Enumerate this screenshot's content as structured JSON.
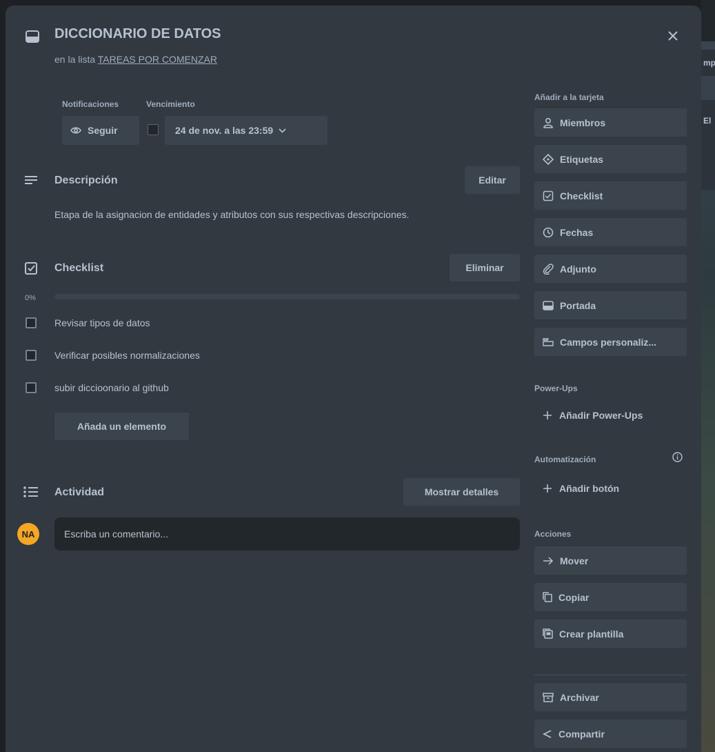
{
  "card": {
    "title": "DICCIONARIO DE DATOS",
    "list_prefix": "en la lista",
    "list_name": "TAREAS POR COMENZAR"
  },
  "meta": {
    "notifications_label": "Notificaciones",
    "due_label": "Vencimiento",
    "follow_button": "Seguir",
    "due_value": "24 de nov. a las 23:59"
  },
  "description": {
    "heading": "Descripción",
    "edit_button": "Editar",
    "text": "Etapa de la asignacion de entidades y atributos con sus respectivas descripciones."
  },
  "checklist": {
    "heading": "Checklist",
    "delete_button": "Eliminar",
    "progress_label": "0%",
    "progress_fraction": 0,
    "items": [
      {
        "text": "Revisar tipos de datos",
        "checked": false
      },
      {
        "text": "Verificar posibles normalizaciones",
        "checked": false
      },
      {
        "text": "subir diccioonario al github",
        "checked": false
      }
    ],
    "add_item_button": "Añada un elemento"
  },
  "activity": {
    "heading": "Actividad",
    "details_button": "Mostrar detalles",
    "avatar_initials": "NA",
    "comment_placeholder": "Escriba un comentario..."
  },
  "sidebar": {
    "add_to_card_heading": "Añadir a la tarjeta",
    "add_to_card": [
      {
        "label": "Miembros",
        "icon": "person-icon"
      },
      {
        "label": "Etiquetas",
        "icon": "tag-icon"
      },
      {
        "label": "Checklist",
        "icon": "checklist-icon"
      },
      {
        "label": "Fechas",
        "icon": "clock-icon"
      },
      {
        "label": "Adjunto",
        "icon": "paperclip-icon"
      },
      {
        "label": "Portada",
        "icon": "cover-icon"
      },
      {
        "label": "Campos personaliz...",
        "icon": "custom-fields-icon"
      }
    ],
    "powerups_heading": "Power-Ups",
    "add_powerups": "Añadir Power-Ups",
    "automation_heading": "Automatización",
    "add_button": "Añadir botón",
    "actions_heading": "Acciones",
    "actions": [
      {
        "label": "Mover",
        "icon": "arrow-right-icon"
      },
      {
        "label": "Copiar",
        "icon": "copy-icon"
      },
      {
        "label": "Crear plantilla",
        "icon": "template-icon"
      }
    ],
    "secondary_actions": [
      {
        "label": "Archivar",
        "icon": "archive-icon"
      },
      {
        "label": "Compartir",
        "icon": "share-icon"
      }
    ]
  },
  "background": {
    "peek_text_1": "mp",
    "peek_text_2": "El"
  },
  "colors": {
    "modal_bg": "#323940",
    "button_bg": "#3b444c",
    "text": "#b6c2cf",
    "avatar": "#f5a623"
  }
}
